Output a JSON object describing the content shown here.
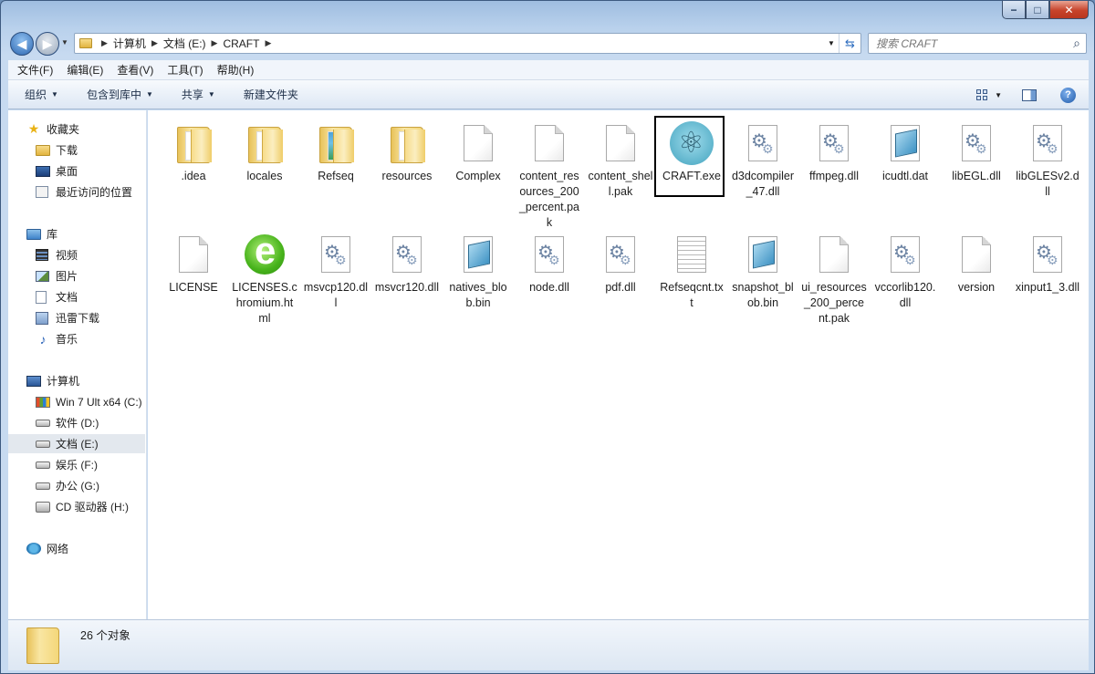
{
  "window": {
    "minimize_label": "−",
    "maximize_label": "□",
    "close_label": "✕"
  },
  "address": {
    "breadcrumbs": [
      "计算机",
      "文档 (E:)",
      "CRAFT"
    ]
  },
  "search": {
    "placeholder": "搜索 CRAFT"
  },
  "menubar": {
    "items": [
      "文件(F)",
      "编辑(E)",
      "查看(V)",
      "工具(T)",
      "帮助(H)"
    ]
  },
  "toolbar": {
    "organize": "组织",
    "include_library": "包含到库中",
    "share": "共享",
    "new_folder": "新建文件夹",
    "help": "?"
  },
  "sidebar": {
    "items": [
      {
        "label": "收藏夹",
        "icon": "star-icon"
      },
      {
        "label": "下载",
        "icon": "folder-icon"
      },
      {
        "label": "桌面",
        "icon": "desktop-icon"
      },
      {
        "label": "最近访问的位置",
        "icon": "recent-places-icon"
      },
      {
        "label": "库",
        "icon": "library-icon"
      },
      {
        "label": "视频",
        "icon": "video-icon"
      },
      {
        "label": "图片",
        "icon": "picture-icon"
      },
      {
        "label": "文档",
        "icon": "document-icon"
      },
      {
        "label": "迅雷下载",
        "icon": "download-folder-icon"
      },
      {
        "label": "音乐",
        "icon": "music-icon"
      },
      {
        "label": "计算机",
        "icon": "computer-icon"
      },
      {
        "label": "Win 7 Ult x64 (C:)",
        "icon": "windows-drive-icon"
      },
      {
        "label": "软件 (D:)",
        "icon": "drive-icon"
      },
      {
        "label": "文档 (E:)",
        "icon": "drive-icon",
        "selected": true
      },
      {
        "label": "娱乐 (F:)",
        "icon": "drive-icon"
      },
      {
        "label": "办公 (G:)",
        "icon": "drive-icon"
      },
      {
        "label": "CD 驱动器 (H:)",
        "icon": "cd-drive-icon"
      },
      {
        "label": "网络",
        "icon": "network-icon"
      }
    ]
  },
  "files": [
    {
      "name": ".idea",
      "type": "folder"
    },
    {
      "name": "locales",
      "type": "folder"
    },
    {
      "name": "Refseq",
      "type": "folder-colored"
    },
    {
      "name": "resources",
      "type": "folder"
    },
    {
      "name": "Complex",
      "type": "blank"
    },
    {
      "name": "content_resources_200_percent.pak",
      "type": "blank"
    },
    {
      "name": "content_shell.pak",
      "type": "blank"
    },
    {
      "name": "CRAFT.exe",
      "type": "craft",
      "selected": true
    },
    {
      "name": "d3dcompiler_47.dll",
      "type": "dll"
    },
    {
      "name": "ffmpeg.dll",
      "type": "dll"
    },
    {
      "name": "icudtl.dat",
      "type": "dat"
    },
    {
      "name": "libEGL.dll",
      "type": "dll"
    },
    {
      "name": "libGLESv2.dll",
      "type": "dll"
    },
    {
      "name": "LICENSE",
      "type": "blank"
    },
    {
      "name": "LICENSES.chromium.html",
      "type": "ie"
    },
    {
      "name": "msvcp120.dll",
      "type": "dll"
    },
    {
      "name": "msvcr120.dll",
      "type": "dll"
    },
    {
      "name": "natives_blob.bin",
      "type": "dat"
    },
    {
      "name": "node.dll",
      "type": "dll"
    },
    {
      "name": "pdf.dll",
      "type": "dll"
    },
    {
      "name": "Refseqcnt.txt",
      "type": "txt"
    },
    {
      "name": "snapshot_blob.bin",
      "type": "dat"
    },
    {
      "name": "ui_resources_200_percent.pak",
      "type": "blank"
    },
    {
      "name": "vccorlib120.dll",
      "type": "dll"
    },
    {
      "name": "version",
      "type": "blank"
    },
    {
      "name": "xinput1_3.dll",
      "type": "dll"
    }
  ],
  "status": {
    "count_text": "26 个对象"
  }
}
